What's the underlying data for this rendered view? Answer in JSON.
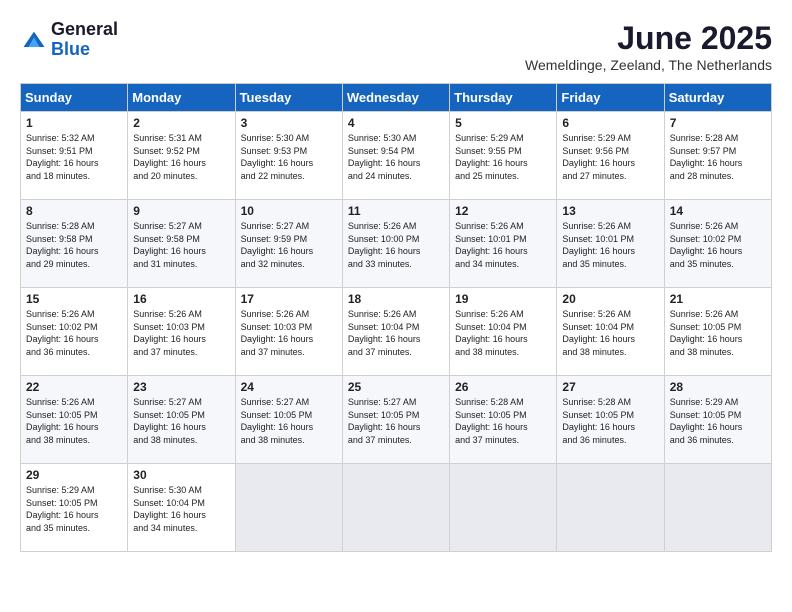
{
  "logo": {
    "general": "General",
    "blue": "Blue"
  },
  "header": {
    "month": "June 2025",
    "location": "Wemeldinge, Zeeland, The Netherlands"
  },
  "weekdays": [
    "Sunday",
    "Monday",
    "Tuesday",
    "Wednesday",
    "Thursday",
    "Friday",
    "Saturday"
  ],
  "weeks": [
    [
      {
        "day": "1",
        "info": "Sunrise: 5:32 AM\nSunset: 9:51 PM\nDaylight: 16 hours\nand 18 minutes."
      },
      {
        "day": "2",
        "info": "Sunrise: 5:31 AM\nSunset: 9:52 PM\nDaylight: 16 hours\nand 20 minutes."
      },
      {
        "day": "3",
        "info": "Sunrise: 5:30 AM\nSunset: 9:53 PM\nDaylight: 16 hours\nand 22 minutes."
      },
      {
        "day": "4",
        "info": "Sunrise: 5:30 AM\nSunset: 9:54 PM\nDaylight: 16 hours\nand 24 minutes."
      },
      {
        "day": "5",
        "info": "Sunrise: 5:29 AM\nSunset: 9:55 PM\nDaylight: 16 hours\nand 25 minutes."
      },
      {
        "day": "6",
        "info": "Sunrise: 5:29 AM\nSunset: 9:56 PM\nDaylight: 16 hours\nand 27 minutes."
      },
      {
        "day": "7",
        "info": "Sunrise: 5:28 AM\nSunset: 9:57 PM\nDaylight: 16 hours\nand 28 minutes."
      }
    ],
    [
      {
        "day": "8",
        "info": "Sunrise: 5:28 AM\nSunset: 9:58 PM\nDaylight: 16 hours\nand 29 minutes."
      },
      {
        "day": "9",
        "info": "Sunrise: 5:27 AM\nSunset: 9:58 PM\nDaylight: 16 hours\nand 31 minutes."
      },
      {
        "day": "10",
        "info": "Sunrise: 5:27 AM\nSunset: 9:59 PM\nDaylight: 16 hours\nand 32 minutes."
      },
      {
        "day": "11",
        "info": "Sunrise: 5:26 AM\nSunset: 10:00 PM\nDaylight: 16 hours\nand 33 minutes."
      },
      {
        "day": "12",
        "info": "Sunrise: 5:26 AM\nSunset: 10:01 PM\nDaylight: 16 hours\nand 34 minutes."
      },
      {
        "day": "13",
        "info": "Sunrise: 5:26 AM\nSunset: 10:01 PM\nDaylight: 16 hours\nand 35 minutes."
      },
      {
        "day": "14",
        "info": "Sunrise: 5:26 AM\nSunset: 10:02 PM\nDaylight: 16 hours\nand 35 minutes."
      }
    ],
    [
      {
        "day": "15",
        "info": "Sunrise: 5:26 AM\nSunset: 10:02 PM\nDaylight: 16 hours\nand 36 minutes."
      },
      {
        "day": "16",
        "info": "Sunrise: 5:26 AM\nSunset: 10:03 PM\nDaylight: 16 hours\nand 37 minutes."
      },
      {
        "day": "17",
        "info": "Sunrise: 5:26 AM\nSunset: 10:03 PM\nDaylight: 16 hours\nand 37 minutes."
      },
      {
        "day": "18",
        "info": "Sunrise: 5:26 AM\nSunset: 10:04 PM\nDaylight: 16 hours\nand 37 minutes."
      },
      {
        "day": "19",
        "info": "Sunrise: 5:26 AM\nSunset: 10:04 PM\nDaylight: 16 hours\nand 38 minutes."
      },
      {
        "day": "20",
        "info": "Sunrise: 5:26 AM\nSunset: 10:04 PM\nDaylight: 16 hours\nand 38 minutes."
      },
      {
        "day": "21",
        "info": "Sunrise: 5:26 AM\nSunset: 10:05 PM\nDaylight: 16 hours\nand 38 minutes."
      }
    ],
    [
      {
        "day": "22",
        "info": "Sunrise: 5:26 AM\nSunset: 10:05 PM\nDaylight: 16 hours\nand 38 minutes."
      },
      {
        "day": "23",
        "info": "Sunrise: 5:27 AM\nSunset: 10:05 PM\nDaylight: 16 hours\nand 38 minutes."
      },
      {
        "day": "24",
        "info": "Sunrise: 5:27 AM\nSunset: 10:05 PM\nDaylight: 16 hours\nand 38 minutes."
      },
      {
        "day": "25",
        "info": "Sunrise: 5:27 AM\nSunset: 10:05 PM\nDaylight: 16 hours\nand 37 minutes."
      },
      {
        "day": "26",
        "info": "Sunrise: 5:28 AM\nSunset: 10:05 PM\nDaylight: 16 hours\nand 37 minutes."
      },
      {
        "day": "27",
        "info": "Sunrise: 5:28 AM\nSunset: 10:05 PM\nDaylight: 16 hours\nand 36 minutes."
      },
      {
        "day": "28",
        "info": "Sunrise: 5:29 AM\nSunset: 10:05 PM\nDaylight: 16 hours\nand 36 minutes."
      }
    ],
    [
      {
        "day": "29",
        "info": "Sunrise: 5:29 AM\nSunset: 10:05 PM\nDaylight: 16 hours\nand 35 minutes."
      },
      {
        "day": "30",
        "info": "Sunrise: 5:30 AM\nSunset: 10:04 PM\nDaylight: 16 hours\nand 34 minutes."
      },
      {
        "day": "",
        "info": ""
      },
      {
        "day": "",
        "info": ""
      },
      {
        "day": "",
        "info": ""
      },
      {
        "day": "",
        "info": ""
      },
      {
        "day": "",
        "info": ""
      }
    ]
  ]
}
